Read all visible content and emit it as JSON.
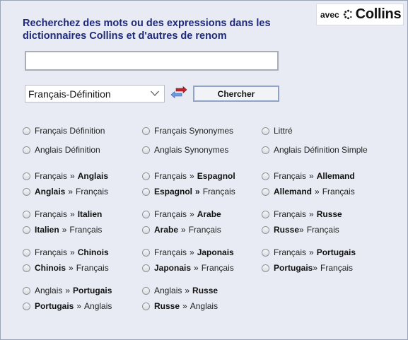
{
  "heading": {
    "line1": "Recherchez des mots ou des expressions dans les",
    "line2": "dictionnaires Collins et d'autres de renom"
  },
  "brand": {
    "avec": "avec",
    "name": "Collins"
  },
  "search": {
    "value": "",
    "placeholder": ""
  },
  "dictionary_select": {
    "selected": "Français-Définition"
  },
  "submit_label": "Chercher",
  "options": {
    "r0c0": "Français Définition",
    "r0c1": "Français Synonymes",
    "r0c2": "Littré",
    "r1c0": "Anglais Définition",
    "r1c1": "Anglais Synonymes",
    "r1c2": "Anglais Définition Simple",
    "r2c0": {
      "from": "Français",
      "sep": "»",
      "to": "Anglais"
    },
    "r2c1": {
      "from": "Français",
      "sep": "»",
      "to": "Espagnol"
    },
    "r2c2": {
      "from": "Français",
      "sep": "»",
      "to": "Allemand"
    },
    "r3c0": {
      "from": "Anglais",
      "sep": "»",
      "to": "Français"
    },
    "r3c1": {
      "from": "Espagnol",
      "sep": "»",
      "to": "Français"
    },
    "r3c2": {
      "from": "Allemand",
      "sep": "»",
      "to": "Français"
    },
    "r4c0": {
      "from": "Français",
      "sep": "»",
      "to": "Italien"
    },
    "r4c1": {
      "from": "Français",
      "sep": "»",
      "to": "Arabe"
    },
    "r4c2": {
      "from": "Français",
      "sep": "»",
      "to": "Russe"
    },
    "r5c0": {
      "from": "Italien",
      "sep": "»",
      "to": "Français"
    },
    "r5c1": {
      "from": "Arabe",
      "sep": "»",
      "to": "Français"
    },
    "r5c2": {
      "from": "Russe",
      "sep": "»",
      "to": "Français"
    },
    "r6c0": {
      "from": "Français",
      "sep": "»",
      "to": "Chinois"
    },
    "r6c1": {
      "from": "Français",
      "sep": "»",
      "to": "Japonais"
    },
    "r6c2": {
      "from": "Français",
      "sep": "»",
      "to": "Portugais"
    },
    "r7c0": {
      "from": "Chinois",
      "sep": "»",
      "to": "Français"
    },
    "r7c1": {
      "from": "Japonais",
      "sep": "»",
      "to": "Français"
    },
    "r7c2": {
      "from": "Portugais",
      "sep": "»",
      "to": "Français"
    },
    "r8c0": {
      "from": "Anglais",
      "sep": "»",
      "to": "Portugais"
    },
    "r8c1": {
      "from": "Anglais",
      "sep": "»",
      "to": "Russe"
    },
    "r9c0": {
      "from": "Portugais",
      "sep": "»",
      "to": "Anglais"
    },
    "r9c1": {
      "from": "Russe",
      "sep": "»",
      "to": "Anglais"
    }
  },
  "colors": {
    "heading": "#1f2a78",
    "background": "#e8ebf3",
    "arrow_red": "#c0232c",
    "arrow_blue": "#4a78c8"
  },
  "icons": [
    "chevron-down-icon",
    "swap-arrows-icon",
    "collins-logo-icon",
    "radio-icon"
  ]
}
